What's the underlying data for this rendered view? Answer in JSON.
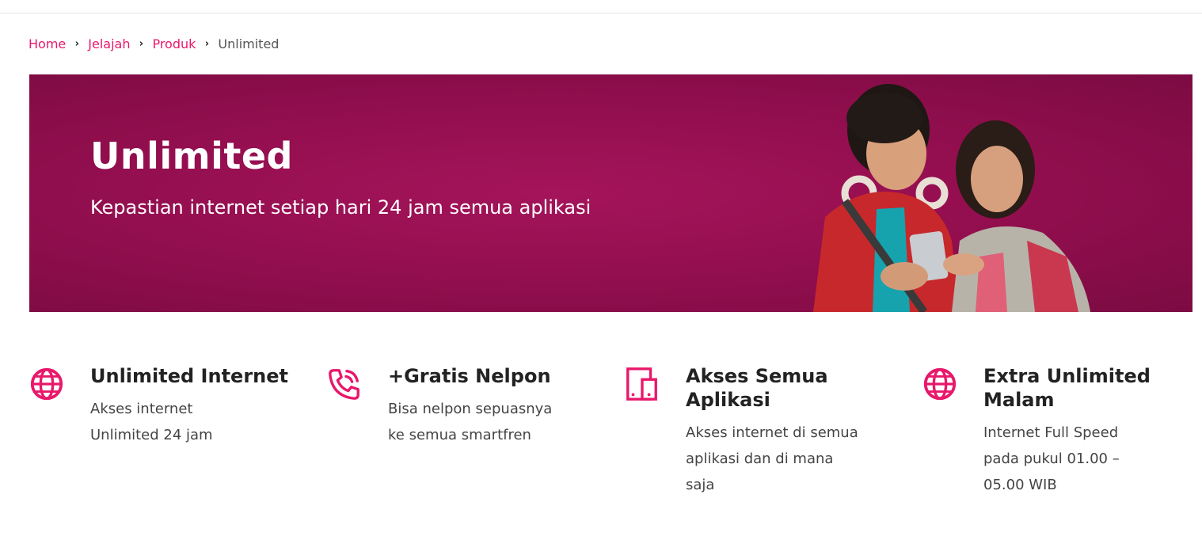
{
  "breadcrumb": {
    "items": [
      "Home",
      "Jelajah",
      "Produk"
    ],
    "current": "Unlimited"
  },
  "hero": {
    "title": "Unlimited",
    "subtitle": "Kepastian internet setiap hari 24 jam semua aplikasi"
  },
  "features": [
    {
      "icon": "globe-icon",
      "title": "Unlimited Internet",
      "desc_lines": [
        "Akses internet",
        "Unlimited 24 jam"
      ]
    },
    {
      "icon": "phone-call-icon",
      "title": "+Gratis Nelpon",
      "desc_lines": [
        "Bisa nelpon sepuasnya",
        "ke semua smartfren"
      ]
    },
    {
      "icon": "devices-icon",
      "title_lines": [
        "Akses Semua",
        "Aplikasi"
      ],
      "desc_lines": [
        "Akses internet di semua",
        "aplikasi dan di mana",
        "saja"
      ]
    },
    {
      "icon": "globe-icon",
      "title_lines": [
        "Extra Unlimited",
        "Malam"
      ],
      "desc_lines": [
        "Internet Full Speed",
        "pada pukul 01.00 –",
        "05.00 WIB"
      ]
    }
  ],
  "colors": {
    "accent": "#e8186b",
    "hero_bg": "#950f50"
  }
}
